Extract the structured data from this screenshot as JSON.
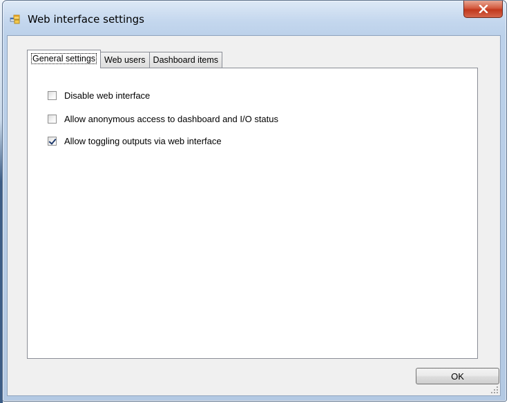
{
  "window": {
    "title": "Web interface settings",
    "close_glyph": "X",
    "icon": "app-window-icon",
    "colors": {
      "title_gradient_top": "#dde9f6",
      "title_gradient_bottom": "#b3c9e3",
      "close_red": "#c1381d",
      "client_bg": "#f0f0f0",
      "check_mark": "#1f3b6d"
    }
  },
  "tabs": [
    {
      "label": "General settings",
      "active": true
    },
    {
      "label": "Web users",
      "active": false
    },
    {
      "label": "Dashboard items",
      "active": false
    }
  ],
  "options": [
    {
      "label": "Disable web interface",
      "checked": false
    },
    {
      "label": "Allow anonymous access to dashboard and I/O status",
      "checked": false
    },
    {
      "label": "Allow toggling outputs via web interface",
      "checked": true
    }
  ],
  "buttons": {
    "ok_label": "OK"
  }
}
